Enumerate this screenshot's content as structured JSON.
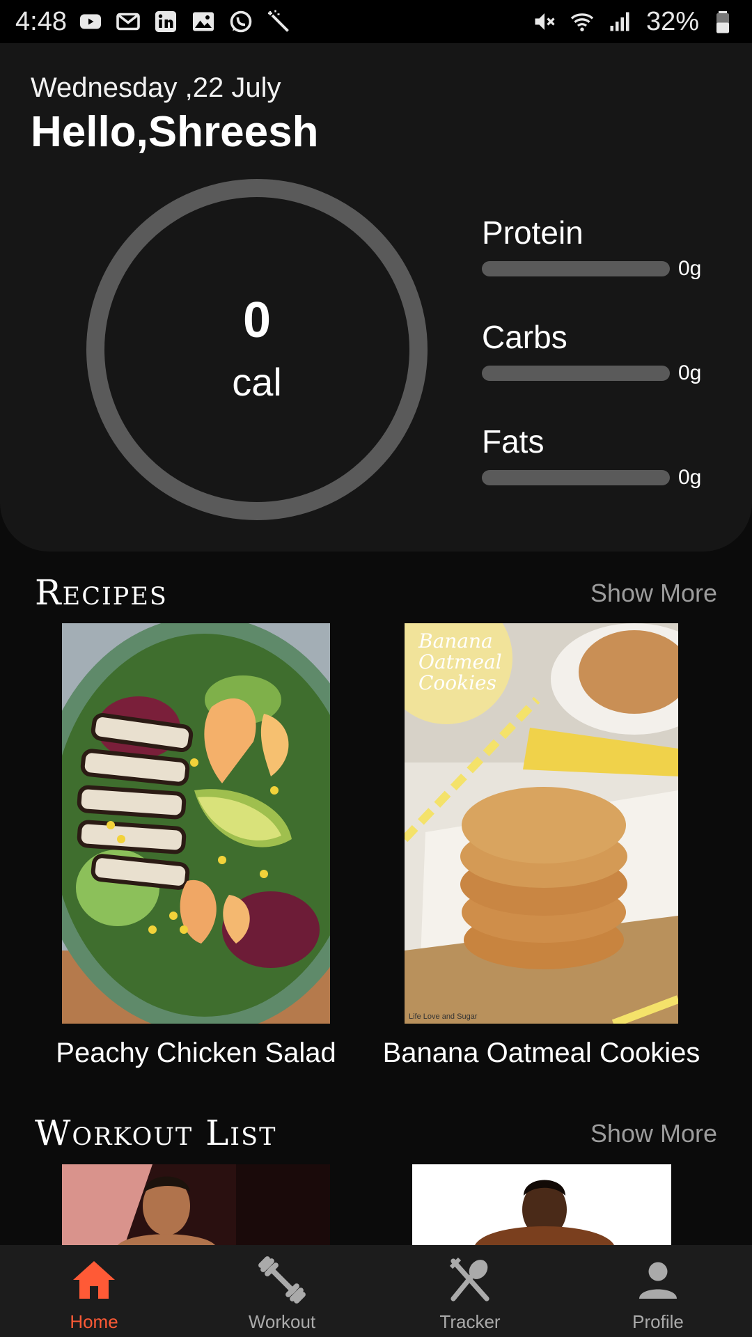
{
  "status_bar": {
    "time": "4:48",
    "left_icons": [
      "youtube-icon",
      "gmail-icon",
      "linkedin-icon",
      "gallery-icon",
      "whatsapp-icon",
      "magic-wand-icon"
    ],
    "right_icons": [
      "mute-icon",
      "wifi-icon",
      "signal-icon",
      "battery-icon"
    ],
    "battery": "32%"
  },
  "header": {
    "date": "Wednesday ,22 July",
    "greeting": "Hello,Shreesh"
  },
  "calories": {
    "value": "0",
    "unit": "cal"
  },
  "macros": [
    {
      "label": "Protein",
      "value": "0g",
      "fraction": 0
    },
    {
      "label": "Carbs",
      "value": "0g",
      "fraction": 0
    },
    {
      "label": "Fats",
      "value": "0g",
      "fraction": 0
    }
  ],
  "recipes": {
    "title": "Recipes",
    "show_more": "Show More",
    "items": [
      {
        "name": "Peachy Chicken Salad"
      },
      {
        "name": "Banana Oatmeal Cookies",
        "image_text": "Banana Oatmeal Cookies",
        "credit": "Life Love and Sugar"
      }
    ]
  },
  "workouts": {
    "title": "Workout List",
    "show_more": "Show More"
  },
  "nav": [
    {
      "label": "Home",
      "icon": "home-icon",
      "active": true
    },
    {
      "label": "Workout",
      "icon": "dumbbell-icon",
      "active": false
    },
    {
      "label": "Tracker",
      "icon": "fork-knife-icon",
      "active": false
    },
    {
      "label": "Profile",
      "icon": "person-icon",
      "active": false
    }
  ],
  "colors": {
    "accent": "#ff5a36",
    "background": "#0b0b0b",
    "card": "#161616",
    "ring": "#5a5a5a",
    "nav_bg": "#1c1c1c"
  }
}
